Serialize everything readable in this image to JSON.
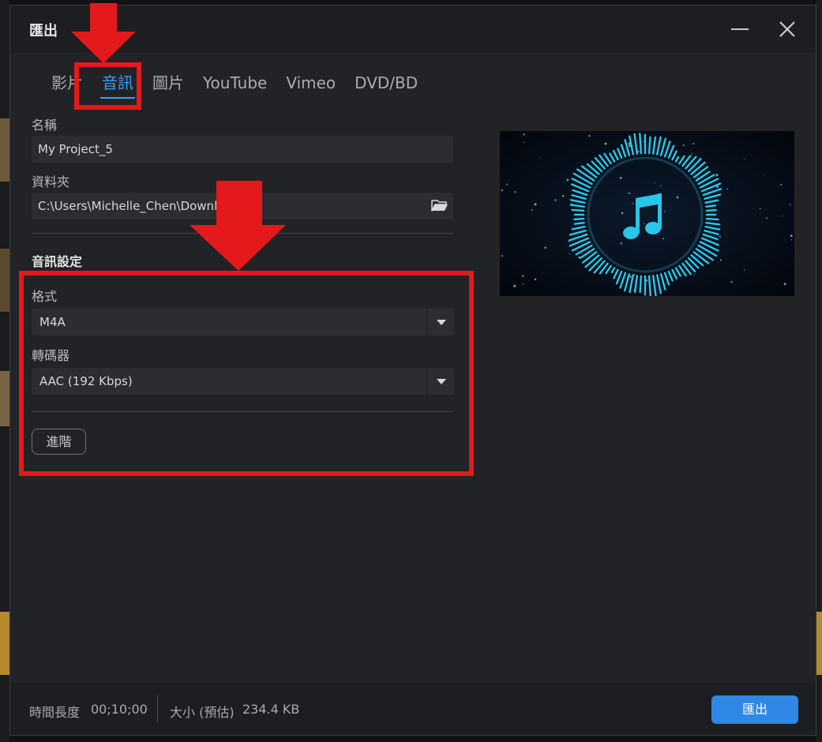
{
  "dialog": {
    "title": "匯出",
    "minimize_glyph": "—",
    "close_glyph": "✕"
  },
  "tabs": [
    {
      "label": "影片",
      "active": false
    },
    {
      "label": "音訊",
      "active": true
    },
    {
      "label": "圖片",
      "active": false
    },
    {
      "label": "YouTube",
      "active": false
    },
    {
      "label": "Vimeo",
      "active": false
    },
    {
      "label": "DVD/BD",
      "active": false
    }
  ],
  "form": {
    "name_label": "名稱",
    "name_value": "My Project_5",
    "folder_label": "資料夾",
    "folder_value": "C:\\Users\\Michelle_Chen\\Downlo",
    "audio_settings_title": "音訊設定",
    "format_label": "格式",
    "format_value": "M4A",
    "encoder_label": "轉碼器",
    "encoder_value": "AAC (192 Kbps)",
    "advanced_label": "進階"
  },
  "footer": {
    "duration_label": "時間長度",
    "duration_value": "00;10;00",
    "size_label": "大小 (預估)",
    "size_value": "234.4 KB",
    "export_label": "匯出"
  },
  "icons": {
    "folder": "folder-open-icon",
    "music": "music-note-icon",
    "dropdown": "chevron-down-icon"
  },
  "colors": {
    "accent": "#2f87e6",
    "tab_active": "#3d9bf0",
    "annotation_red": "#e3191c",
    "preview_glow": "#27c7e8"
  }
}
